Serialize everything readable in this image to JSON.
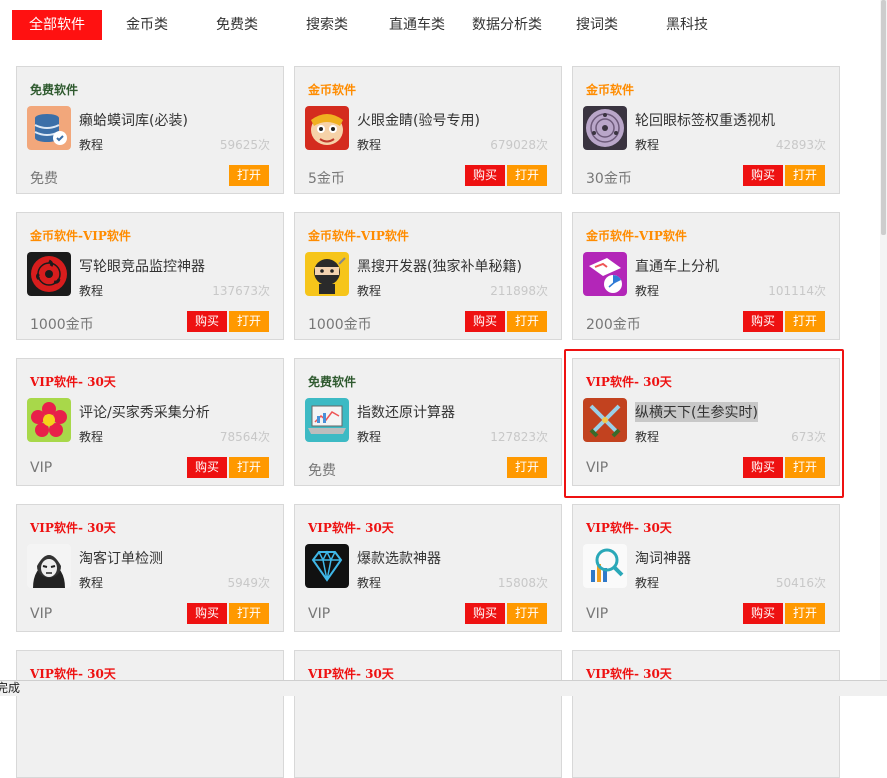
{
  "tabs": [
    {
      "label": "全部软件",
      "active": true
    },
    {
      "label": "金币类"
    },
    {
      "label": "免费类"
    },
    {
      "label": "搜索类"
    },
    {
      "label": "直通车类"
    },
    {
      "label": "数据分析类"
    },
    {
      "label": "搜词类"
    },
    {
      "label": "黑科技"
    }
  ],
  "buy_label": "购买",
  "open_label": "打开",
  "tutorial_label": "教程",
  "cards": [
    {
      "type": "免费软件",
      "type_class": "free",
      "name": "癞蛤蟆词库(必装)",
      "count": "59625次",
      "price": "免费",
      "buy": false,
      "icon": "database-icon"
    },
    {
      "type": "金币软件",
      "type_class": "gold",
      "name": "火眼金睛(验号专用)",
      "count": "679028次",
      "price": "5金币",
      "buy": true,
      "icon": "monkey-king-icon"
    },
    {
      "type": "金币软件",
      "type_class": "gold",
      "name": "轮回眼标签权重透视机",
      "count": "42893次",
      "price": "30金币",
      "buy": true,
      "icon": "rinnegan-eye-icon"
    },
    {
      "type": "金币软件-VIP软件",
      "type_class": "gold",
      "name": "写轮眼竞品监控神器",
      "count": "137673次",
      "price": "1000金币",
      "buy": true,
      "icon": "sharingan-eye-icon"
    },
    {
      "type": "金币软件-VIP软件",
      "type_class": "gold",
      "name": "黑搜开发器(独家补单秘籍)",
      "count": "211898次",
      "price": "1000金币",
      "buy": true,
      "icon": "ninja-icon"
    },
    {
      "type": "金币软件-VIP软件",
      "type_class": "gold",
      "name": "直通车上分机",
      "count": "101114次",
      "price": "200金币",
      "buy": true,
      "icon": "pie-chart-icon"
    },
    {
      "type": "VIP软件- 30天",
      "type_class": "vip",
      "name": "评论/买家秀采集分析",
      "count": "78564次",
      "price": "VIP",
      "buy": true,
      "icon": "flower-icon"
    },
    {
      "type": "免费软件",
      "type_class": "free",
      "name": "指数还原计算器",
      "count": "127823次",
      "price": "免费",
      "buy": false,
      "icon": "laptop-chart-icon"
    },
    {
      "type": "VIP软件- 30天",
      "type_class": "vip",
      "name": "纵横天下(生参实时)",
      "count": "673次",
      "price": "VIP",
      "buy": true,
      "icon": "crossed-swords-icon",
      "highlight": true
    },
    {
      "type": "VIP软件- 30天",
      "type_class": "vip",
      "name": "淘客订单检测",
      "count": "5949次",
      "price": "VIP",
      "buy": true,
      "icon": "hooded-figure-icon"
    },
    {
      "type": "VIP软件- 30天",
      "type_class": "vip",
      "name": "爆款选款神器",
      "count": "15808次",
      "price": "VIP",
      "buy": true,
      "icon": "diamond-icon"
    },
    {
      "type": "VIP软件- 30天",
      "type_class": "vip",
      "name": "淘词神器",
      "count": "50416次",
      "price": "VIP",
      "buy": true,
      "icon": "magnifier-chart-icon"
    },
    {
      "type": "VIP软件- 30天",
      "type_class": "vip"
    },
    {
      "type": "VIP软件- 30天",
      "type_class": "vip"
    },
    {
      "type": "VIP软件- 30天",
      "type_class": "vip"
    }
  ],
  "status_text": "完成"
}
